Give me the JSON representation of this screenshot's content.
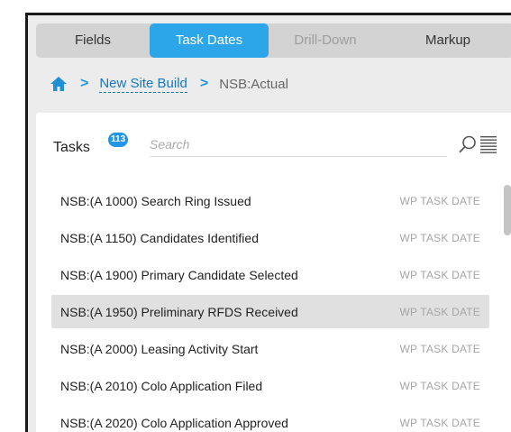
{
  "tabs": [
    {
      "label": "Fields",
      "state": "default"
    },
    {
      "label": "Task Dates",
      "state": "active"
    },
    {
      "label": "Drill-Down",
      "state": "disabled"
    },
    {
      "label": "Markup",
      "state": "default"
    }
  ],
  "breadcrumb": {
    "home_icon": "home-icon",
    "separator": ">",
    "link": "New Site Build",
    "current": "NSB:Actual"
  },
  "tasks": {
    "title": "Tasks",
    "count": "113",
    "search_placeholder": "Search",
    "search_value": ""
  },
  "rows": [
    {
      "label": "NSB:(A 1000) Search Ring Issued",
      "type": "WP TASK DATE",
      "selected": false
    },
    {
      "label": "NSB:(A 1150) Candidates Identified",
      "type": "WP TASK DATE",
      "selected": false
    },
    {
      "label": "NSB:(A 1900) Primary Candidate Selected",
      "type": "WP TASK DATE",
      "selected": false
    },
    {
      "label": "NSB:(A 1950) Preliminary RFDS Received",
      "type": "WP TASK DATE",
      "selected": true
    },
    {
      "label": "NSB:(A 2000) Leasing Activity Start",
      "type": "WP TASK DATE",
      "selected": false
    },
    {
      "label": "NSB:(A 2010) Colo Application Filed",
      "type": "WP TASK DATE",
      "selected": false
    },
    {
      "label": "NSB:(A 2020) Colo Application Approved",
      "type": "WP TASK DATE",
      "selected": false
    }
  ],
  "colors": {
    "accent": "#2da6e9",
    "link": "#1777c0",
    "selected_row": "#e0e0e0"
  }
}
